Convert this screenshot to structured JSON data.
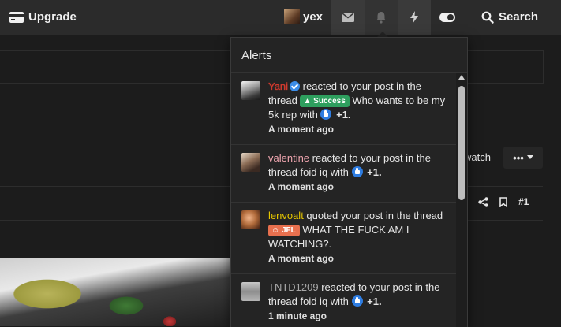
{
  "header": {
    "upgrade_label": "Upgrade",
    "username": "yex",
    "search_label": "Search"
  },
  "thread": {
    "watch_label": "watch",
    "post_number": "#1"
  },
  "alerts": {
    "title": "Alerts",
    "items": [
      {
        "user": "Yani",
        "verified": true,
        "text": " reacted to your post in the thread ",
        "badge": "Success",
        "thread": " Who wants to be my 5k rep with ",
        "reaction": "+1.",
        "time": "A moment ago"
      },
      {
        "user": "valentine",
        "text": " reacted to your post in the thread ",
        "thread": "foid iq with ",
        "reaction": "+1.",
        "time": "A moment ago"
      },
      {
        "user": "lenvoalt",
        "text": " quoted your post in the thread ",
        "badge": "JFL",
        "thread": " WHAT THE FUCK AM I WATCHING?.",
        "time": "A moment ago"
      },
      {
        "user": "TNTD1209",
        "text": " reacted to your post in the thread ",
        "thread": "foid iq with ",
        "reaction": "+1.",
        "time": "1 minute ago"
      }
    ]
  },
  "colors": {
    "accent_success": "#2e9f5e",
    "accent_jfl": "#e8704e",
    "like_blue": "#2f7de1"
  }
}
